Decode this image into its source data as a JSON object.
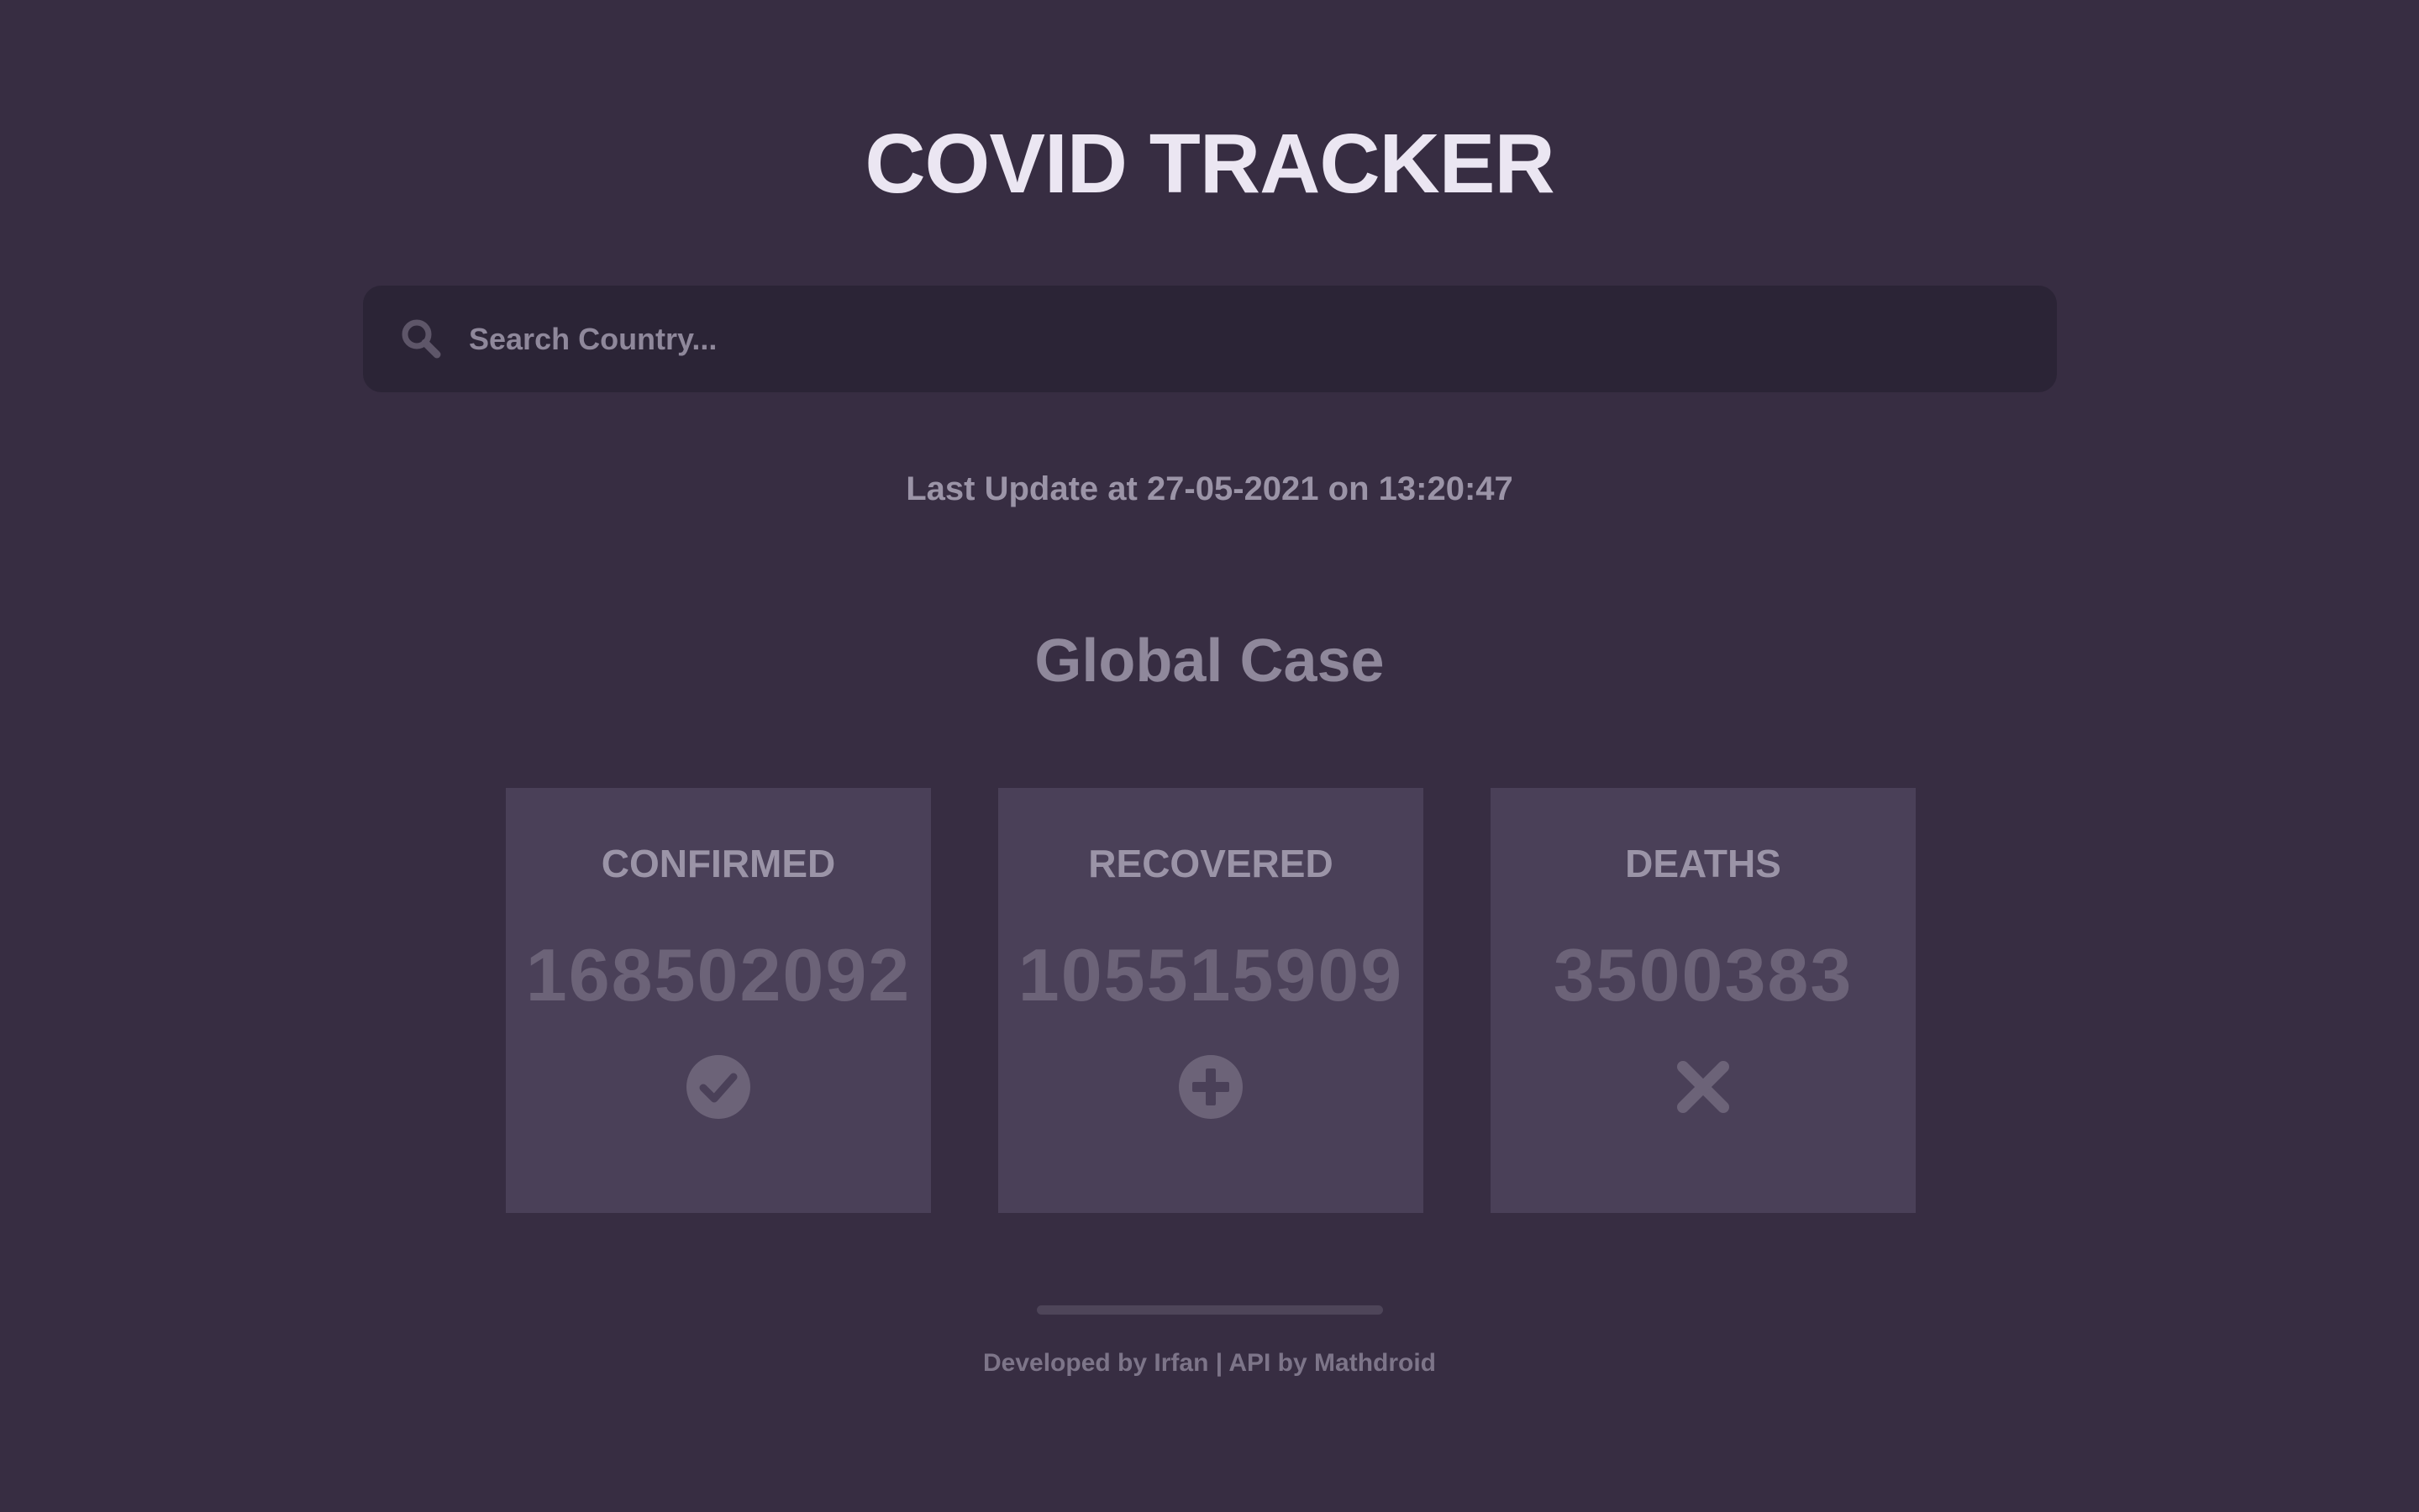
{
  "header": {
    "title": "COVID TRACKER"
  },
  "search": {
    "placeholder": "Search Country...",
    "value": "",
    "icon": "search-icon"
  },
  "last_update": {
    "text": "Last Update at 27-05-2021 on 13:20:47"
  },
  "global": {
    "title": "Global Case",
    "cards": [
      {
        "label": "CONFIRMED",
        "value": "168502092",
        "icon": "check-circle-icon"
      },
      {
        "label": "RECOVERED",
        "value": "105515909",
        "icon": "plus-circle-icon"
      },
      {
        "label": "DEATHS",
        "value": "3500383",
        "icon": "close-icon"
      }
    ]
  },
  "footer": {
    "text": "Developed by Irfan | API by Mathdroid"
  },
  "colors": {
    "background": "#372d42",
    "search_background": "#2b2436",
    "card_background": "#4a4058",
    "title": "#ebe6f2",
    "muted_text": "#9b94a7",
    "value_text": "#6c6378",
    "icon": "#6c6378"
  }
}
